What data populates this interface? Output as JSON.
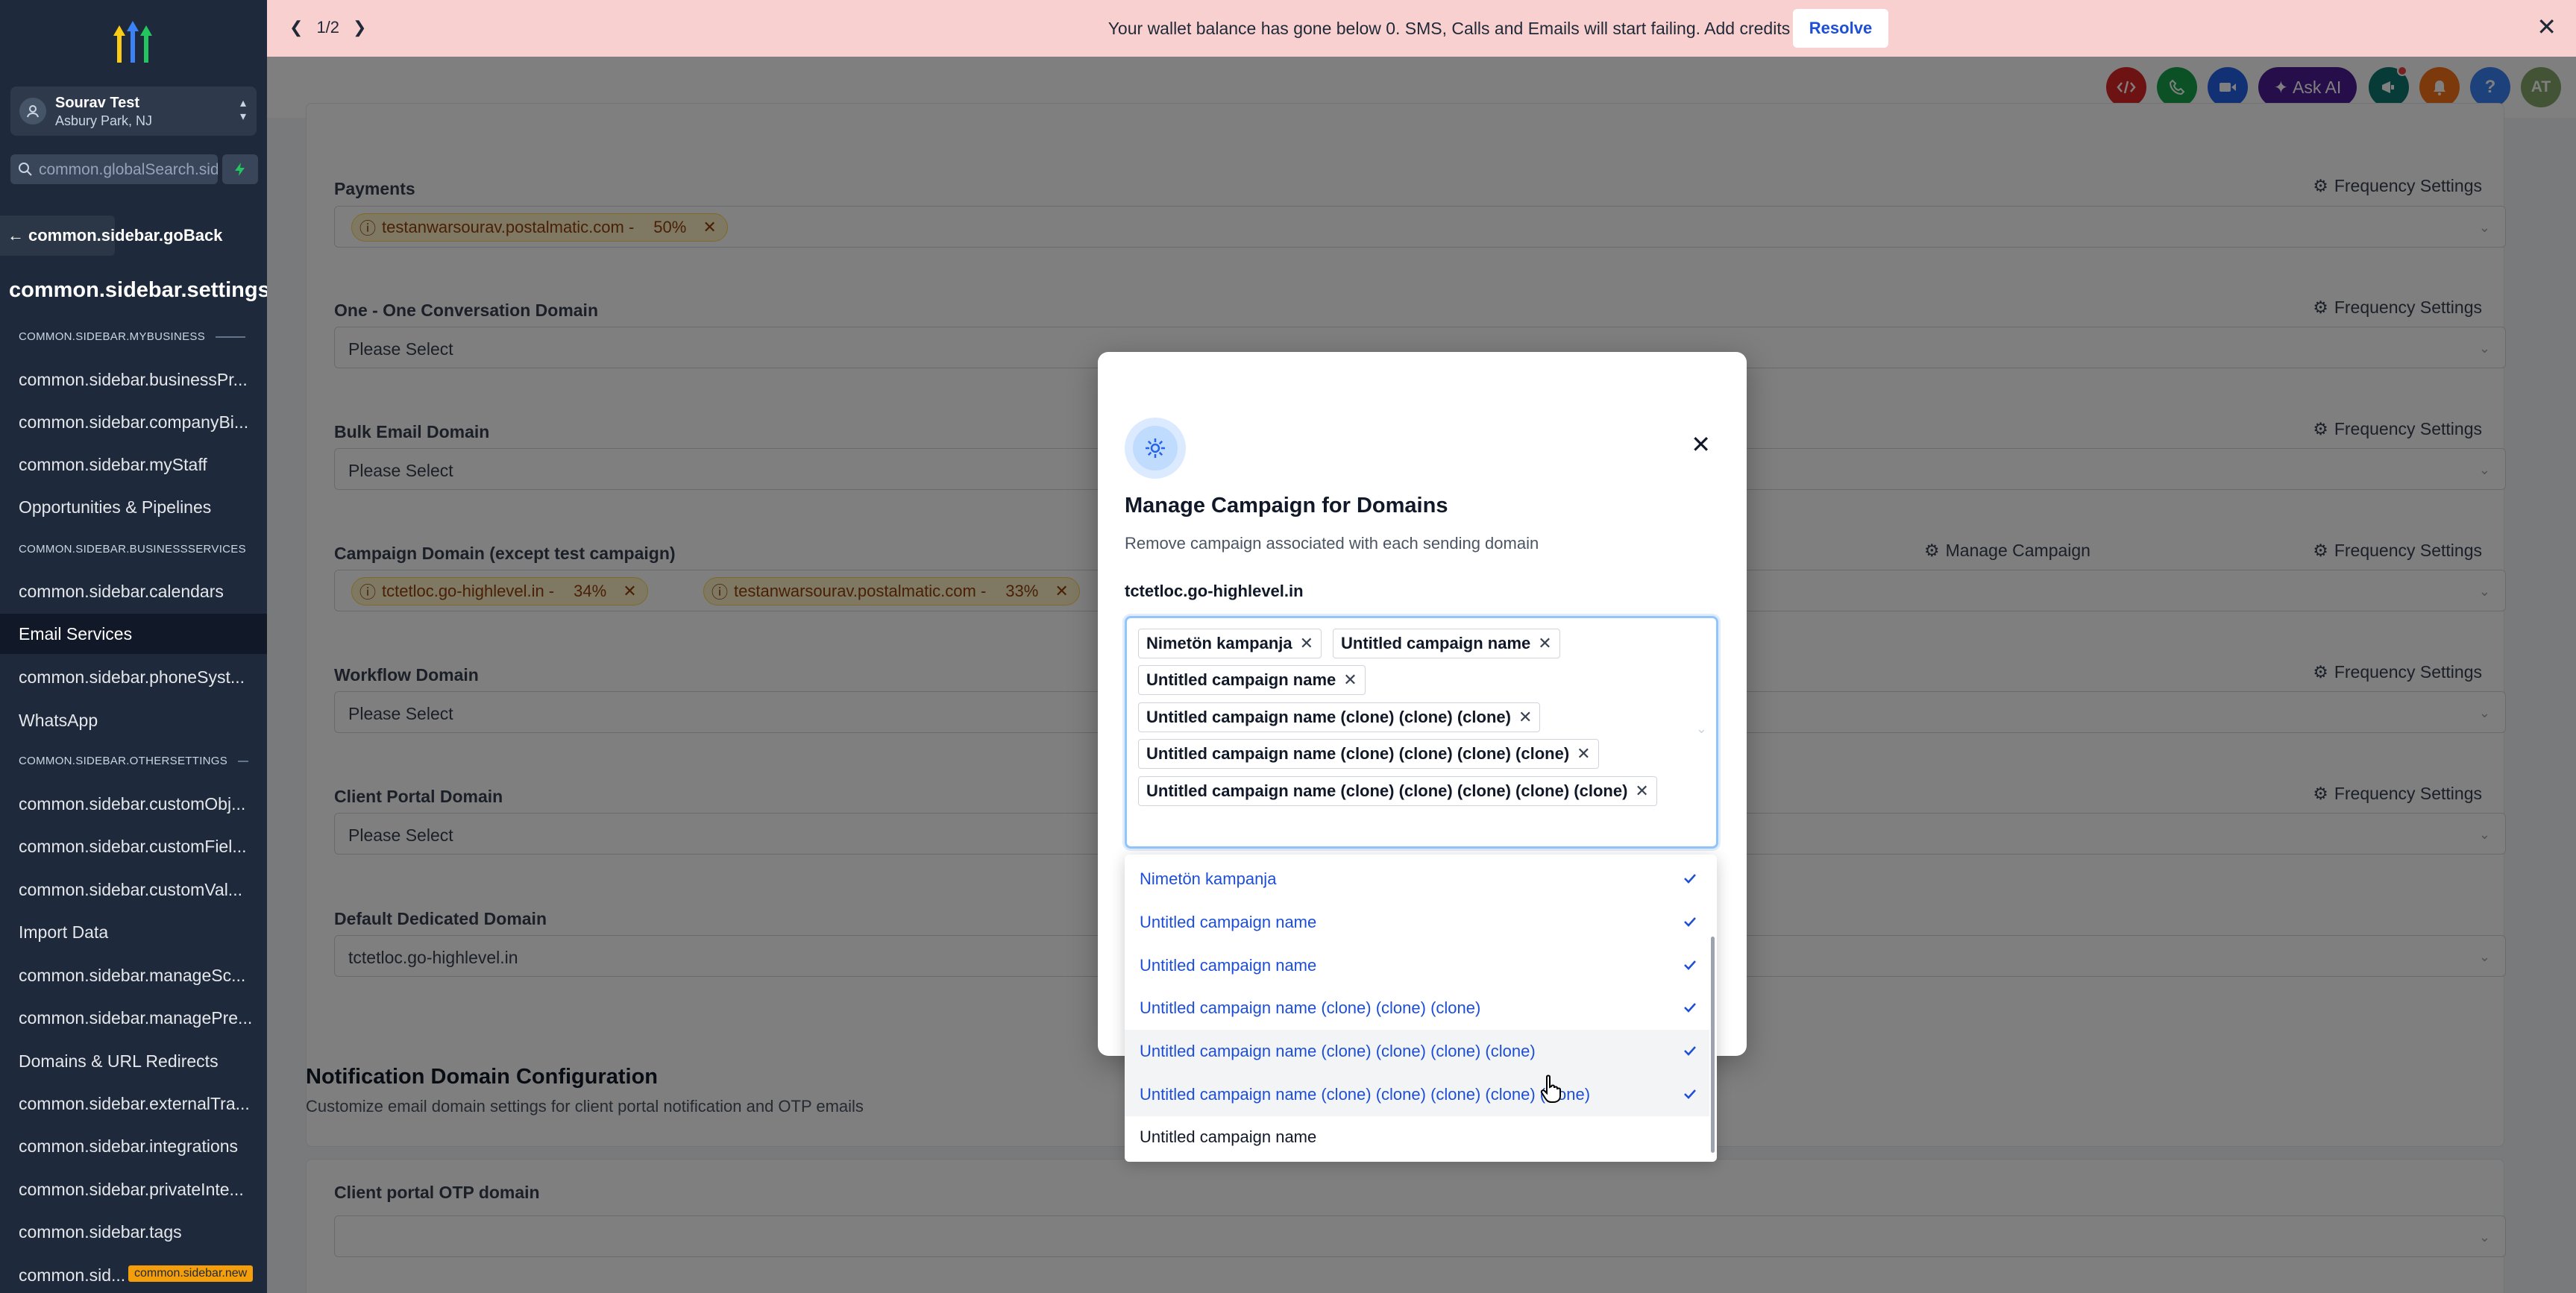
{
  "banner": {
    "pager": "1/2",
    "message": "Your wallet balance has gone below 0. SMS, Calls and Emails will start failing. Add credits immediately.",
    "resolve_label": "Resolve"
  },
  "header": {
    "ask_ai_label": "Ask AI",
    "avatar_initials": "AT",
    "help_label": "?"
  },
  "sidebar": {
    "account_name": "Sourav Test",
    "account_location": "Asbury Park, NJ",
    "search_placeholder": "common.globalSearch.sidebar",
    "go_back": "common.sidebar.goBack",
    "title": "common.sidebar.settings",
    "sections": [
      "COMMON.SIDEBAR.MYBUSINESS",
      "COMMON.SIDEBAR.BUSINESSSERVICES",
      "COMMON.SIDEBAR.OTHERSETTINGS"
    ],
    "items": [
      "common.sidebar.businessPr...",
      "common.sidebar.companyBi...",
      "common.sidebar.myStaff",
      "Opportunities & Pipelines",
      "common.sidebar.calendars",
      "Email Services",
      "common.sidebar.phoneSyst...",
      "WhatsApp",
      "common.sidebar.customObj...",
      "common.sidebar.customFiel...",
      "common.sidebar.customVal...",
      "Import Data",
      "common.sidebar.manageSc...",
      "common.sidebar.managePre...",
      "Domains & URL Redirects",
      "common.sidebar.externalTra...",
      "common.sidebar.integrations",
      "common.sidebar.privateInte...",
      "common.sidebar.tags",
      "common.sid..."
    ],
    "new_badge": "common.sidebar.new"
  },
  "main": {
    "frequency_label": "Frequency Settings",
    "manage_campaign_label": "Manage Campaign",
    "placeholder": "Please Select",
    "fields": {
      "payments": "Payments",
      "one_one": "One - One Conversation Domain",
      "bulk": "Bulk Email Domain",
      "campaign": "Campaign Domain (except test campaign)",
      "workflow": "Workflow Domain",
      "client_portal": "Client Portal Domain",
      "default_dedicated": "Default Dedicated Domain",
      "otp": "Client portal OTP domain"
    },
    "payments_chip": {
      "domain": "testanwarsourav.postalmatic.com -",
      "pct": "50%"
    },
    "campaign_chips": [
      {
        "domain": "tctetloc.go-highlevel.in -",
        "pct": "34%"
      },
      {
        "domain": "testanwarsourav.postalmatic.com -",
        "pct": "33%"
      }
    ],
    "default_dedicated_value": "tctetloc.go-highlevel.in",
    "notification_title": "Notification Domain Configuration",
    "notification_sub": "Customize email domain settings for client portal notification and OTP emails"
  },
  "modal": {
    "title": "Manage Campaign for Domains",
    "subtitle": "Remove campaign associated with each sending domain",
    "domain_label": "tctetloc.go-highlevel.in",
    "chips": [
      "Nimetön kampanja",
      "Untitled campaign name",
      "Untitled campaign name",
      "Untitled campaign name (clone) (clone) (clone)",
      "Untitled campaign name (clone) (clone) (clone) (clone)",
      "Untitled campaign name (clone) (clone) (clone) (clone) (clone)"
    ]
  },
  "dropdown": {
    "options": [
      {
        "label": "Nimetön kampanja",
        "selected": true
      },
      {
        "label": "Untitled campaign name",
        "selected": true
      },
      {
        "label": "Untitled campaign name",
        "selected": true
      },
      {
        "label": "Untitled campaign name (clone) (clone) (clone)",
        "selected": true
      },
      {
        "label": "Untitled campaign name (clone) (clone) (clone) (clone)",
        "selected": true
      },
      {
        "label": "Untitled campaign name (clone) (clone) (clone) (clone) (clone)",
        "selected": true
      },
      {
        "label": "Untitled campaign name",
        "selected": false
      }
    ]
  },
  "colors": {
    "accent": "#1d4ed8",
    "banner_bg": "#f9d0d0",
    "sidebar_bg": "#1e2a3b",
    "chip_bg": "#fef3c7"
  }
}
